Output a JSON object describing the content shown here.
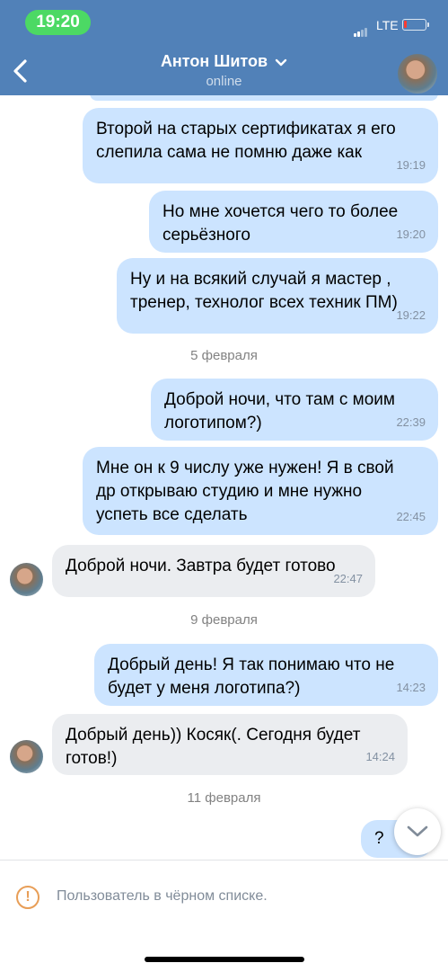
{
  "status_bar": {
    "time": "19:20",
    "network": "LTE"
  },
  "header": {
    "name": "Антон Шитов",
    "status": "online"
  },
  "messages": [
    {
      "side": "out",
      "lines": [
        "Второй на старых сертификатах я его",
        "слепила сама не помню даже как"
      ],
      "time": "19:19"
    },
    {
      "side": "out",
      "lines": [
        "Но мне хочется чего то более",
        "серьёзного"
      ],
      "time": "19:20"
    },
    {
      "side": "out",
      "lines": [
        "Ну и на всякий случай я мастер ,",
        "тренер, технолог всех техник ПМ)"
      ],
      "time": "19:22"
    },
    {
      "side": "out",
      "lines": [
        "Доброй ночи, что там с моим",
        "логотипом?)"
      ],
      "time": "22:39"
    },
    {
      "side": "out",
      "lines": [
        "Мне он к 9 числу уже нужен! Я в свой",
        "др открываю студию и мне нужно",
        "успеть все сделать"
      ],
      "time": "22:45"
    },
    {
      "side": "in",
      "lines": [
        "Доброй ночи. Завтра будет готово"
      ],
      "time": "22:47"
    },
    {
      "side": "out",
      "lines": [
        "Добрый день! Я так понимаю что не",
        "будет у меня логотипа?)"
      ],
      "time": "14:23"
    },
    {
      "side": "in",
      "lines": [
        "Добрый день)) Косяк(. Сегодня будет",
        "готов!)"
      ],
      "time": "14:24"
    },
    {
      "side": "out",
      "lines": [
        "?"
      ],
      "time": ""
    }
  ],
  "dates": [
    "5 февраля",
    "9 февраля",
    "11 февраля"
  ],
  "footer": {
    "blacklist_text": "Пользователь в чёрном списке."
  },
  "colors": {
    "header": "#5181b8",
    "outgoing": "#cce4ff",
    "incoming": "#ebedf0",
    "warning": "#e89e57"
  }
}
